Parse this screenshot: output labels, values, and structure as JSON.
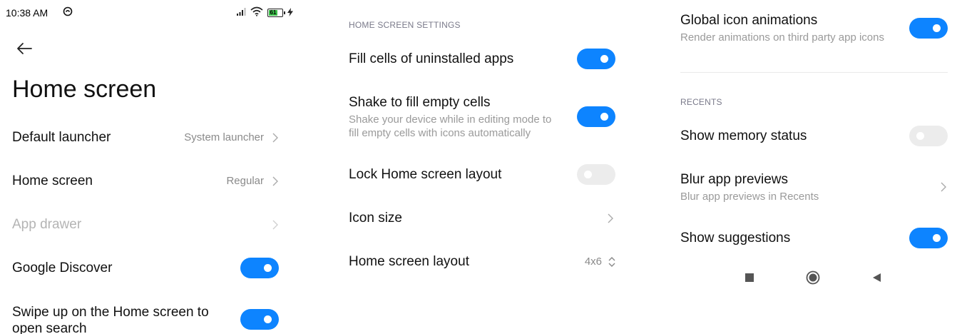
{
  "left": {
    "status": {
      "time": "10:38 AM",
      "battery": "61"
    },
    "title": "Home screen",
    "items": [
      {
        "label": "Default launcher",
        "value": "System launcher"
      },
      {
        "label": "Home screen",
        "value": "Regular"
      },
      {
        "label": "App drawer"
      },
      {
        "label": "Google Discover",
        "toggle": true
      },
      {
        "label_line1": "Swipe up on the Home screen to",
        "label_line2": "open search",
        "toggle": true
      }
    ]
  },
  "middle": {
    "section": "HOME SCREEN SETTINGS",
    "items": [
      {
        "label": "Fill cells of uninstalled apps",
        "toggle": true
      },
      {
        "label": "Shake to fill empty cells",
        "sub_line1": "Shake your device while in editing mode to",
        "sub_line2": "fill empty cells with icons automatically",
        "toggle": true
      },
      {
        "label": "Lock Home screen layout",
        "toggle": false
      },
      {
        "label": "Icon size"
      },
      {
        "label": "Home screen layout",
        "value": "4x6"
      }
    ]
  },
  "right": {
    "items_top": [
      {
        "label": "Global icon animations",
        "sub": "Render animations on third party app icons",
        "toggle": true
      }
    ],
    "section": "RECENTS",
    "items": [
      {
        "label": "Show memory status",
        "toggle": false
      },
      {
        "label": "Blur app previews",
        "sub": "Blur app previews in Recents"
      },
      {
        "label": "Show suggestions",
        "toggle": true
      }
    ],
    "nav": [
      "recents-square-icon",
      "home-circle-icon",
      "back-triangle-icon"
    ]
  },
  "colors": {
    "accent": "#0d84ff",
    "toggle_off": "#ececec",
    "section": "#7a7a8a"
  }
}
